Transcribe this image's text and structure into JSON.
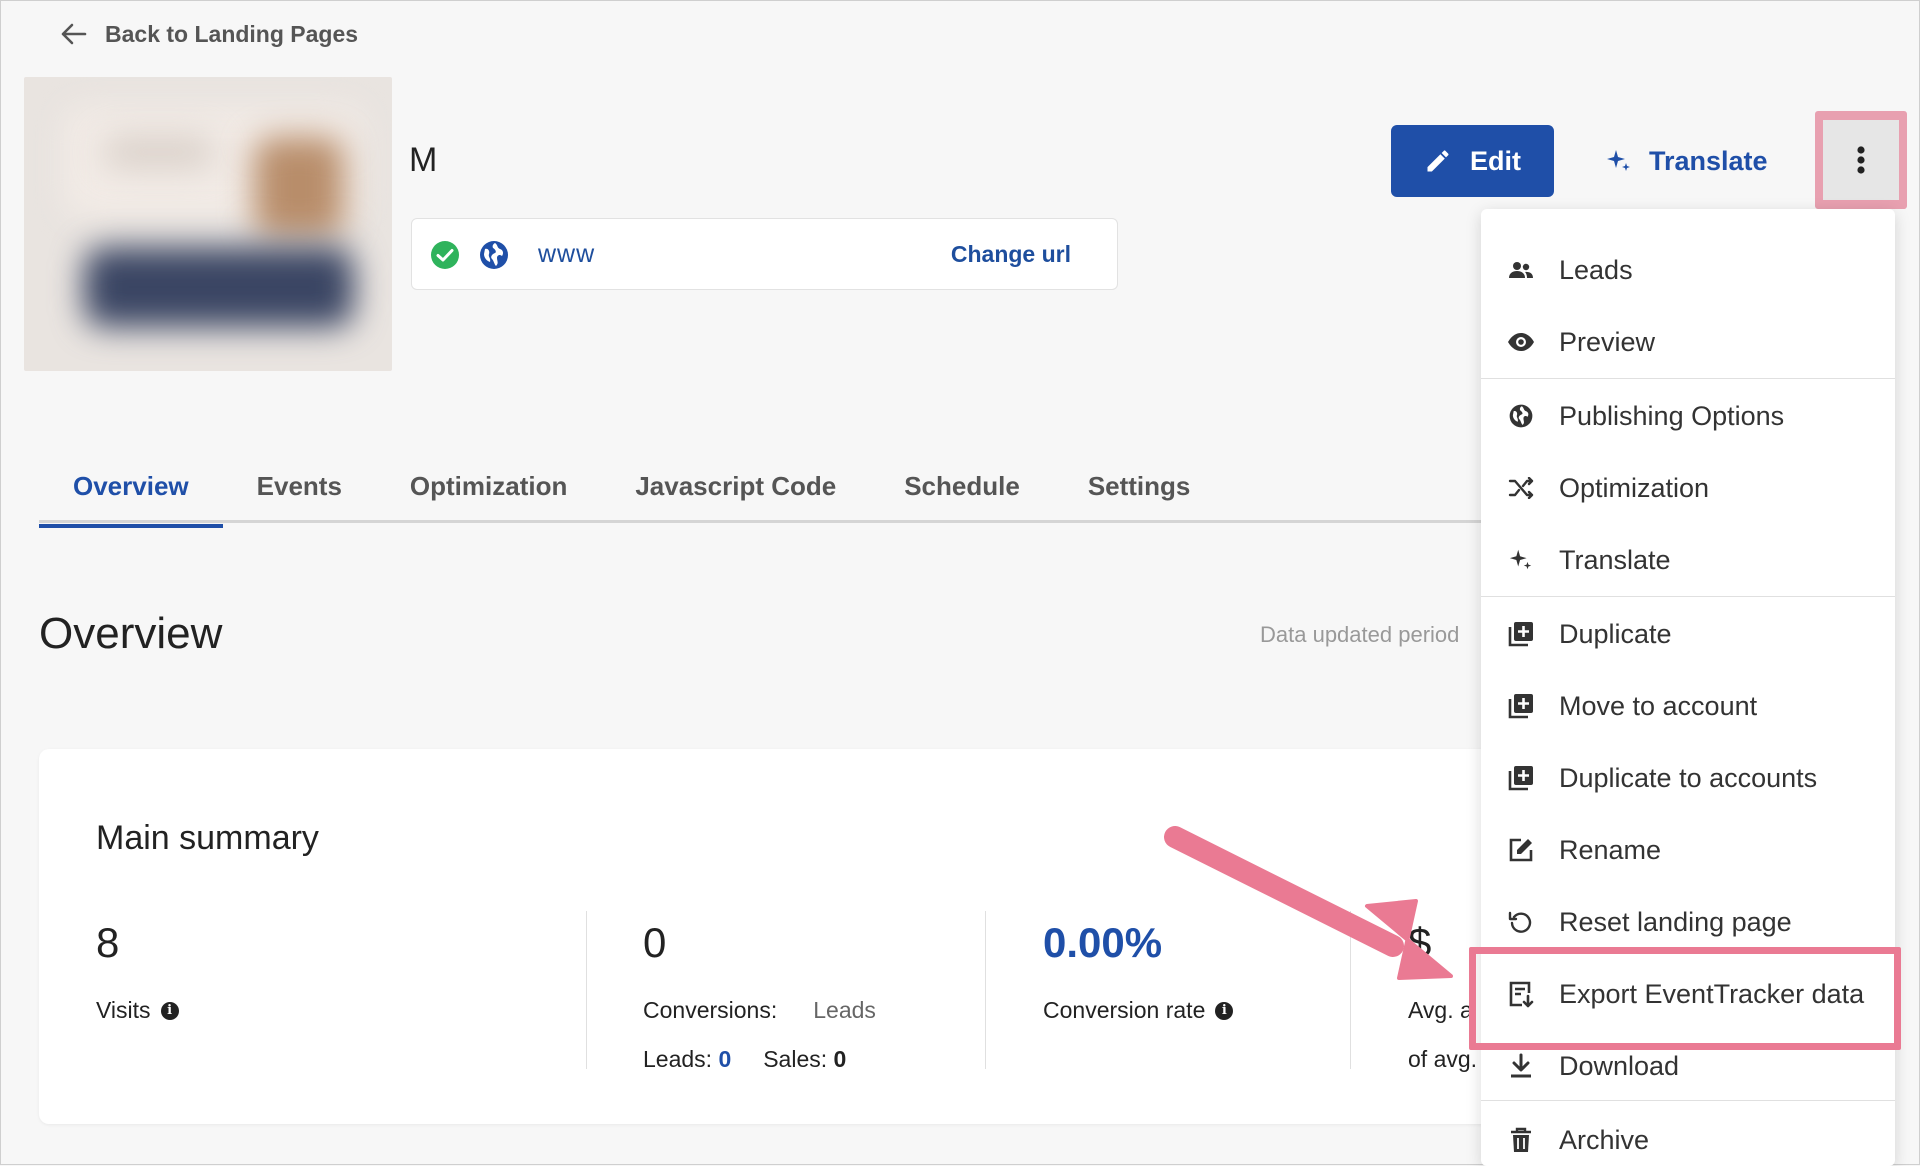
{
  "nav": {
    "back_label": "Back to Landing Pages"
  },
  "page": {
    "title": "M",
    "url": "www",
    "url_status": "published",
    "change_url_label": "Change url"
  },
  "actions": {
    "edit_label": "Edit",
    "translate_label": "Translate"
  },
  "tabs": [
    {
      "label": "Overview",
      "active": true
    },
    {
      "label": "Events"
    },
    {
      "label": "Optimization"
    },
    {
      "label": "Javascript Code"
    },
    {
      "label": "Schedule"
    },
    {
      "label": "Settings"
    }
  ],
  "overview": {
    "heading": "Overview",
    "data_updated": "Data updated period"
  },
  "summary": {
    "title": "Main summary",
    "visits": {
      "value": "8",
      "label": "Visits"
    },
    "conversions": {
      "value": "0",
      "label": "Conversions:",
      "select_value": "Leads",
      "leads_label": "Leads:",
      "leads_value": "0",
      "sales_label": "Sales:",
      "sales_value": "0"
    },
    "conversion_rate": {
      "value": "0.00%",
      "label": "Conversion rate"
    },
    "avg": {
      "value": "$",
      "label": "Avg. a",
      "sub": "of avg."
    }
  },
  "menu": [
    {
      "label": "Leads",
      "icon": "people-icon"
    },
    {
      "label": "Preview",
      "icon": "eye-icon"
    },
    {
      "label": "Publishing Options",
      "icon": "globe-icon"
    },
    {
      "label": "Optimization",
      "icon": "shuffle-icon"
    },
    {
      "label": "Translate",
      "icon": "sparkle-icon"
    },
    {
      "label": "Duplicate",
      "icon": "duplicate-icon"
    },
    {
      "label": "Move to account",
      "icon": "duplicate-icon"
    },
    {
      "label": "Duplicate to accounts",
      "icon": "duplicate-icon"
    },
    {
      "label": "Rename",
      "icon": "edit-square-icon"
    },
    {
      "label": "Reset landing page",
      "icon": "reset-icon"
    },
    {
      "label": "Export EventTracker data",
      "icon": "export-icon",
      "highlighted": true
    },
    {
      "label": "Download",
      "icon": "download-icon"
    },
    {
      "label": "Archive",
      "icon": "trash-icon"
    }
  ],
  "colors": {
    "primary": "#1f4fa8",
    "highlight": "#ea7a93",
    "success": "#2fb35c"
  }
}
